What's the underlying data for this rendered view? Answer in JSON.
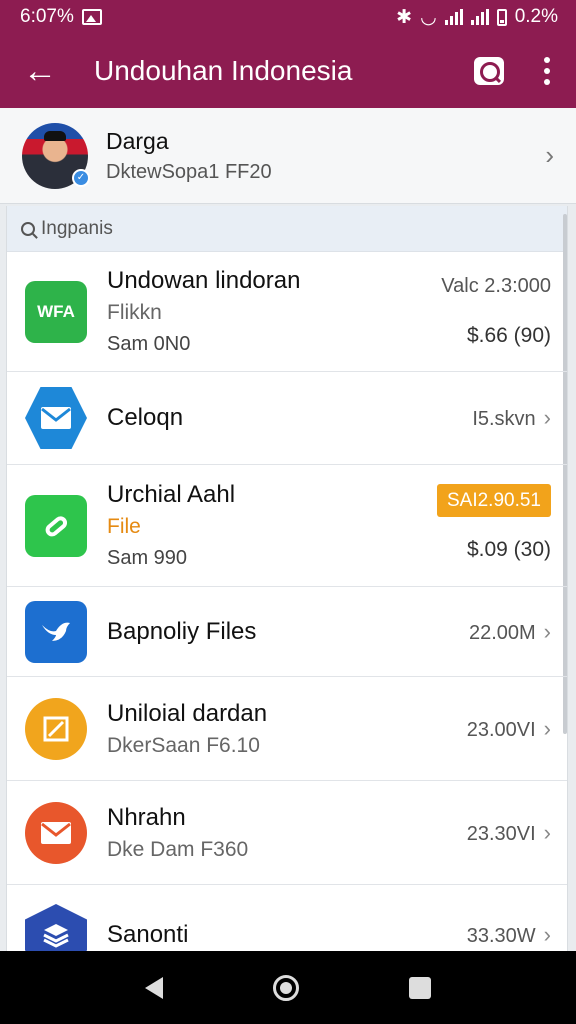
{
  "status_bar": {
    "time": "6:07%",
    "battery": "0.2%"
  },
  "toolbar": {
    "title": "Undouhan Indonesia"
  },
  "account": {
    "name": "Darga",
    "subtitle": "DktewSopa1 FF20"
  },
  "search": {
    "placeholder": "Ingpanis"
  },
  "rows": [
    {
      "title": "Undowan lindoran",
      "subtitle": "Flikkn",
      "detail": "Sam 0N0",
      "right_top": "Valc 2.3:000",
      "right_bottom": "$.66 (90)",
      "icon": "wfa-app-icon",
      "icon_text": "WFA",
      "icon_color": "#2eb34a"
    },
    {
      "title": "Celoqn",
      "right": "I5.skvn",
      "icon": "mail-app-icon",
      "icon_color": "#1e88d8"
    },
    {
      "title": "Urchial Aahl",
      "subtitle": "File",
      "detail": "Sam 990",
      "badge": "SAI2.90.51",
      "right_bottom": "$.09 (30)",
      "icon": "link-app-icon",
      "icon_color": "#2ec54c"
    },
    {
      "title": "Bapnoliy Files",
      "right": "22.00M",
      "icon": "bird-app-icon",
      "icon_color": "#1d6fd0"
    },
    {
      "title": "Uniloial dardan",
      "subtitle": "DkerSaan F6.10",
      "right": "23.00VI",
      "icon": "note-app-icon",
      "icon_color": "#f1a51d"
    },
    {
      "title": "Nhrahn",
      "subtitle": "Dke Dam F360",
      "right": "23.30VI",
      "icon": "envelope-app-icon",
      "icon_color": "#e8572c"
    },
    {
      "title": "Sanonti",
      "right": "33.30W",
      "icon": "layers-app-icon",
      "icon_color": "#2c4db0"
    }
  ],
  "colors": {
    "primary": "#8d1c51",
    "badge": "#f2a31b"
  }
}
